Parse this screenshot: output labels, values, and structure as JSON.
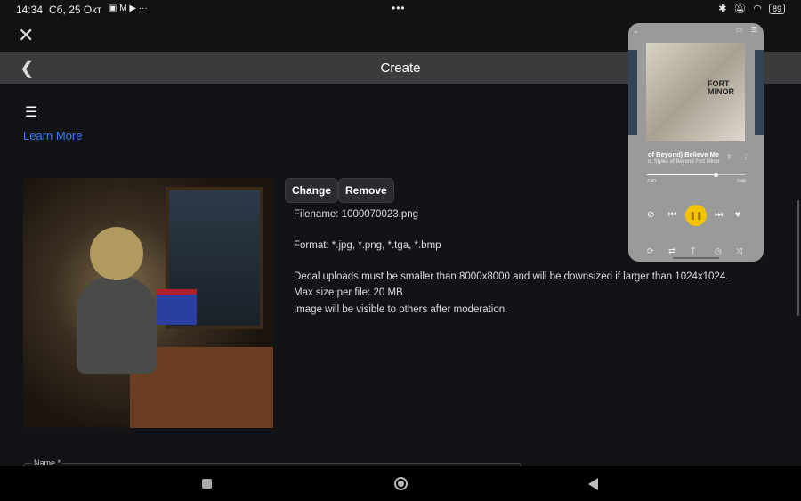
{
  "status_bar": {
    "time": "14:34",
    "date": "Сб, 25 Окт",
    "notification_icons": [
      "wb-icon",
      "gmail-icon",
      "youtube-icon"
    ],
    "more": "···",
    "center_dots": "•••",
    "battery": "89"
  },
  "header": {
    "title": "Create"
  },
  "learn_more": "Learn More",
  "upload": {
    "change_label": "Change",
    "remove_label": "Remove",
    "filename": "Filename: 1000070023.png",
    "format": "Format: *.jpg, *.png, *.tga, *.bmp",
    "size_note": "Decal uploads must be smaller than 8000x8000 and will be downsized if larger than 1024x1024.",
    "max_size": "Max size per file: 20 MB",
    "moderation": "Image will be visible to others after moderation."
  },
  "form": {
    "name_label": "Name *"
  },
  "player": {
    "track": "of Beyond)  Believe Me",
    "artist": "o, Styles of Beyond  Fort Minor",
    "album_art_text": "FORT MINOR",
    "elapsed": "2:40",
    "duration": "3:48",
    "progress": 0.7,
    "accent": "#f5c400"
  }
}
